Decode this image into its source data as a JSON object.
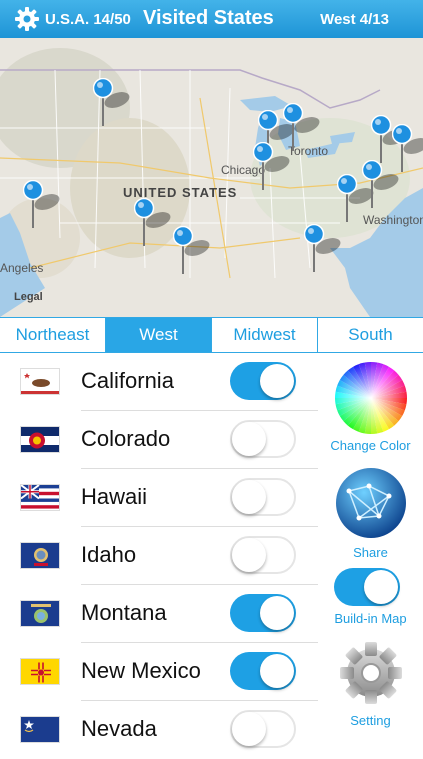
{
  "header": {
    "count_label": "U.S.A. 14/50",
    "title": "Visited States",
    "region_count": "West 4/13"
  },
  "map": {
    "country_label": "UNITED STATES",
    "cities": [
      "Chicago",
      "Toronto",
      "Washington",
      "Angeles"
    ],
    "legal": "Legal"
  },
  "tabs": [
    {
      "label": "Northeast",
      "active": false
    },
    {
      "label": "West",
      "active": true
    },
    {
      "label": "Midwest",
      "active": false
    },
    {
      "label": "South",
      "active": false
    }
  ],
  "states": [
    {
      "name": "California",
      "visited": true
    },
    {
      "name": "Colorado",
      "visited": false
    },
    {
      "name": "Hawaii",
      "visited": false
    },
    {
      "name": "Idaho",
      "visited": false
    },
    {
      "name": "Montana",
      "visited": true
    },
    {
      "name": "New Mexico",
      "visited": true
    },
    {
      "name": "Nevada",
      "visited": false
    }
  ],
  "side": {
    "change_color": "Change Color",
    "share": "Share",
    "buildin_map": "Build-in Map",
    "buildin_on": true,
    "setting": "Setting"
  },
  "colors": {
    "accent": "#1ea0e4",
    "pin": "#1e90e0"
  }
}
